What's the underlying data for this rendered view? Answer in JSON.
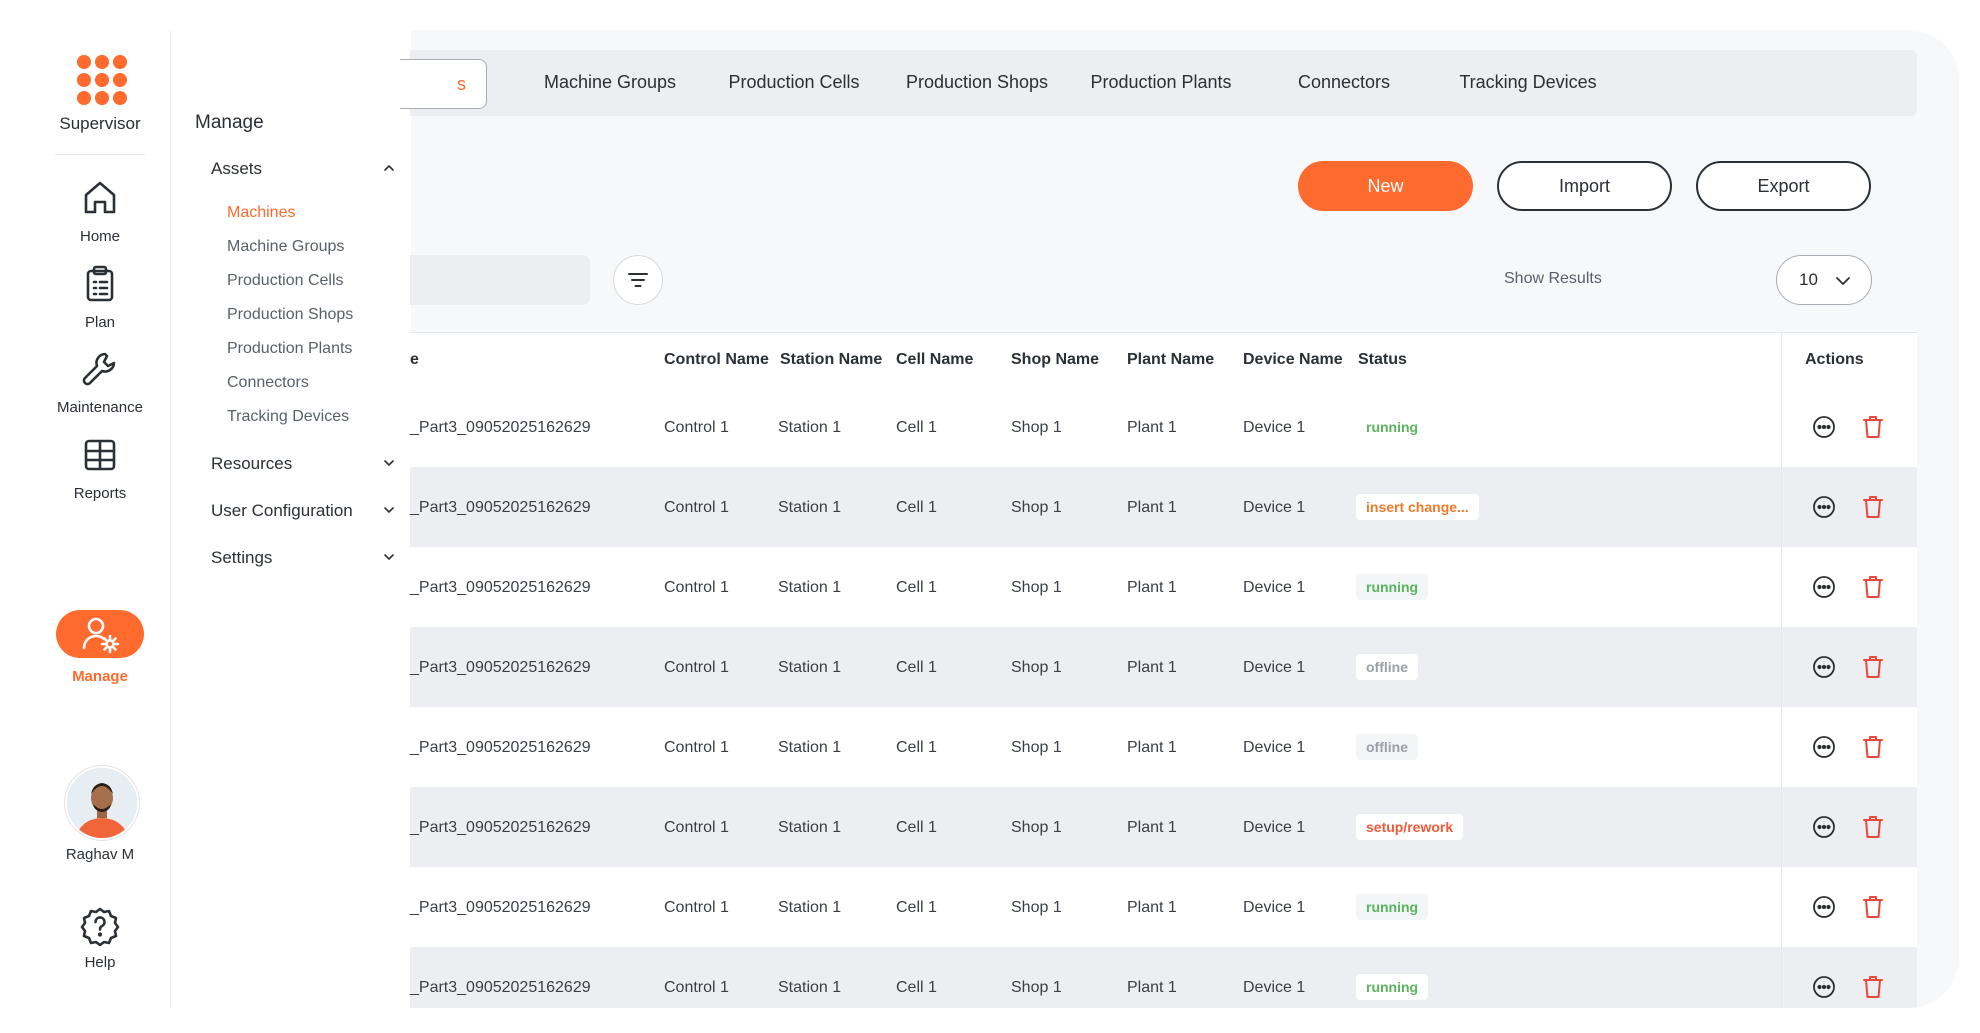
{
  "app": {
    "brand": "Supervisor",
    "accent_color": "#ff6a2e"
  },
  "rail": {
    "items": [
      {
        "label": "Home",
        "icon": "home-icon"
      },
      {
        "label": "Plan",
        "icon": "clipboard-icon"
      },
      {
        "label": "Maintenance",
        "icon": "wrench-icon"
      },
      {
        "label": "Reports",
        "icon": "table-grid-icon"
      },
      {
        "label": "Manage",
        "icon": "user-gear-icon",
        "active": true
      }
    ],
    "user": {
      "name": "Raghav M"
    },
    "help": {
      "label": "Help"
    }
  },
  "submenu": {
    "title": "Manage",
    "groups": [
      {
        "label": "Assets",
        "expanded": true
      },
      {
        "label": "Resources"
      },
      {
        "label": "User Configuration"
      },
      {
        "label": "Settings"
      }
    ],
    "assets": [
      "Machines",
      "Machine Groups",
      "Production Cells",
      "Production Shops",
      "Production Plants",
      "Connectors",
      "Tracking Devices"
    ],
    "active_asset": "Machines"
  },
  "tabs": {
    "active_fragment": "s",
    "items": [
      "Machine Groups",
      "Production Cells",
      "Production Shops",
      "Production Plants",
      "Connectors",
      "Tracking Devices"
    ]
  },
  "toolbar": {
    "new_label": "New",
    "import_label": "Import",
    "export_label": "Export",
    "show_results_label": "Show Results",
    "page_size": "10"
  },
  "table": {
    "headers": [
      "e",
      "Control Name",
      "Station Name",
      "Cell Name",
      "Shop Name",
      "Plant Name",
      "Device Name",
      "Status",
      "Actions"
    ],
    "rows": [
      {
        "name": "_Part3_09052025162629",
        "control": "Control 1",
        "station": "Station 1",
        "cell": "Cell 1",
        "shop": "Shop 1",
        "plant": "Plant 1",
        "device": "Device 1",
        "status": "running"
      },
      {
        "name": "_Part3_09052025162629",
        "control": "Control 1",
        "station": "Station 1",
        "cell": "Cell 1",
        "shop": "Shop 1",
        "plant": "Plant 1",
        "device": "Device 1",
        "status": "insert change..."
      },
      {
        "name": "_Part3_09052025162629",
        "control": "Control 1",
        "station": "Station 1",
        "cell": "Cell 1",
        "shop": "Shop 1",
        "plant": "Plant 1",
        "device": "Device 1",
        "status": "running"
      },
      {
        "name": "_Part3_09052025162629",
        "control": "Control 1",
        "station": "Station 1",
        "cell": "Cell 1",
        "shop": "Shop 1",
        "plant": "Plant 1",
        "device": "Device 1",
        "status": "offline"
      },
      {
        "name": "_Part3_09052025162629",
        "control": "Control 1",
        "station": "Station 1",
        "cell": "Cell 1",
        "shop": "Shop 1",
        "plant": "Plant 1",
        "device": "Device 1",
        "status": "offline"
      },
      {
        "name": "_Part3_09052025162629",
        "control": "Control 1",
        "station": "Station 1",
        "cell": "Cell 1",
        "shop": "Shop 1",
        "plant": "Plant 1",
        "device": "Device 1",
        "status": "setup/rework"
      },
      {
        "name": "_Part3_09052025162629",
        "control": "Control 1",
        "station": "Station 1",
        "cell": "Cell 1",
        "shop": "Shop 1",
        "plant": "Plant 1",
        "device": "Device 1",
        "status": "running"
      },
      {
        "name": "_Part3_09052025162629",
        "control": "Control 1",
        "station": "Station 1",
        "cell": "Cell 1",
        "shop": "Shop 1",
        "plant": "Plant 1",
        "device": "Device 1",
        "status": "running"
      }
    ]
  }
}
